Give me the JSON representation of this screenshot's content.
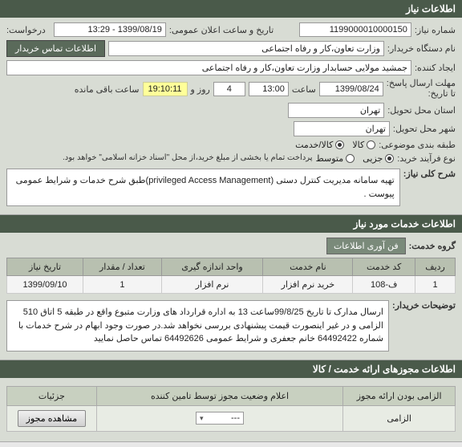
{
  "header": {
    "title": "اطلاعات نیاز"
  },
  "need": {
    "need_no_label": "شماره نیاز:",
    "need_no": "1199000010000150",
    "ann_label": "تاریخ و ساعت اعلان عمومی:",
    "ann_value": "1399/08/19 - 13:29",
    "req_label": "درخواست:",
    "org_label": "نام دستگاه خریدار:",
    "org_value": "وزارت تعاون،کار و رفاه اجتماعی",
    "contact_tab": "اطلاعات تماس خریدار",
    "creator_label": "ایجاد کننده:",
    "creator_value": "جمشید مولایی حسابدار وزارت تعاون،کار و رفاه اجتماعی",
    "deadline_label": "مهلت ارسال پاسخ:",
    "todate_label": "تا تاریخ:",
    "date_val": "1399/08/24",
    "time_label": "ساعت",
    "time_val": "13:00",
    "days": "4",
    "days_label": "روز و",
    "timer": "19:10:11",
    "remain_label": "ساعت باقی مانده",
    "prov_label": "استان محل تحویل:",
    "prov_val": "تهران",
    "city_label": "شهر محل تحویل:",
    "city_val": "تهران",
    "class_label": "طبقه بندی موضوعی:",
    "opt_goods": "کالا",
    "opt_service": "کالا/خدمت",
    "buytype_label": "نوع فرآیند خرید:",
    "opt_partial": "جزیی",
    "opt_medium": "متوسط",
    "pay_note": "پرداخت تمام یا بخشی از مبلغ خرید،از محل \"اسناد خزانه اسلامی\" خواهد بود.",
    "desc_label": "شرح کلی نیاز:",
    "desc_text": "تهیه سامانه مدیریت کنترل دستی (privileged Access Management)طبق شرح خدمات و شرایط عمومی پیوست ."
  },
  "services": {
    "title": "اطلاعات خدمات مورد نیاز",
    "group_label": "گروه خدمت:",
    "group_value": "فن آوری اطلاعات",
    "cols": {
      "row": "ردیف",
      "code": "کد خدمت",
      "name": "نام خدمت",
      "unit": "واحد اندازه گیری",
      "qty": "تعداد / مقدار",
      "due": "تاریخ نیاز"
    },
    "rows": [
      {
        "row": "1",
        "code": "ف-108",
        "name": "خرید نرم افزار",
        "unit": "نرم افزار",
        "qty": "1",
        "due": "1399/09/10"
      }
    ],
    "buyer_note_label": "توضیحات خریدار:",
    "buyer_note": "ارسال مدارک تا تاریخ 99/8/25ساعت 13 به اداره قرارداد های وزارت متبوع واقع در طبقه 5 اتاق 510 الزامی و در غیر اینصورت قیمت پیشنهادی بررسی نخواهد شد.در صورت وجود ابهام در شرح خدمات با شماره 64492422 خانم جعفری و شرایط عمومی 64492626 تماس حاصل نمایید"
  },
  "auth": {
    "title": "اطلاعات مجوزهای ارائه خدمت / کالا",
    "cols": {
      "mandatory": "الزامی بودن ارائه مجوز",
      "status": "اعلام وضعیت مجوز توسط تامین کننده",
      "details": "جزئیات"
    },
    "row": {
      "mandatory": "الزامی",
      "status_placeholder": "---",
      "btn": "مشاهده مجوز"
    }
  }
}
